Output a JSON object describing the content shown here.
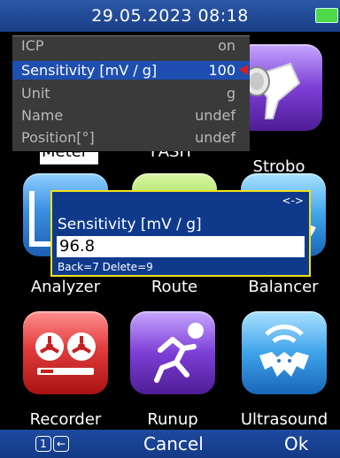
{
  "status": {
    "datetime": "29.05.2023 08:18"
  },
  "overlay": {
    "rows": [
      {
        "key": "ICP",
        "value": "on"
      },
      {
        "key": "Sensitivity [mV / g]",
        "value": "100"
      },
      {
        "key": "Unit",
        "value": "g"
      },
      {
        "key": "Name",
        "value": "undef"
      },
      {
        "key": "Position[°]",
        "value": "undef"
      }
    ]
  },
  "tiles": {
    "meter": "Meter",
    "fast": "FASIT",
    "strobo": "Strobo",
    "analyzer": "Analyzer",
    "route": "Route",
    "balancer": "Balancer",
    "recorder": "Recorder",
    "runup": "Runup",
    "ultrasound": "Ultrasound"
  },
  "dialog": {
    "nav_arrows": "<->",
    "title": "Sensitivity [mV / g]",
    "value": "96.8",
    "hint": "Back=7 Delete=9"
  },
  "bottombar": {
    "key1": "1",
    "key2": "←",
    "cancel": "Cancel",
    "ok": "Ok"
  }
}
